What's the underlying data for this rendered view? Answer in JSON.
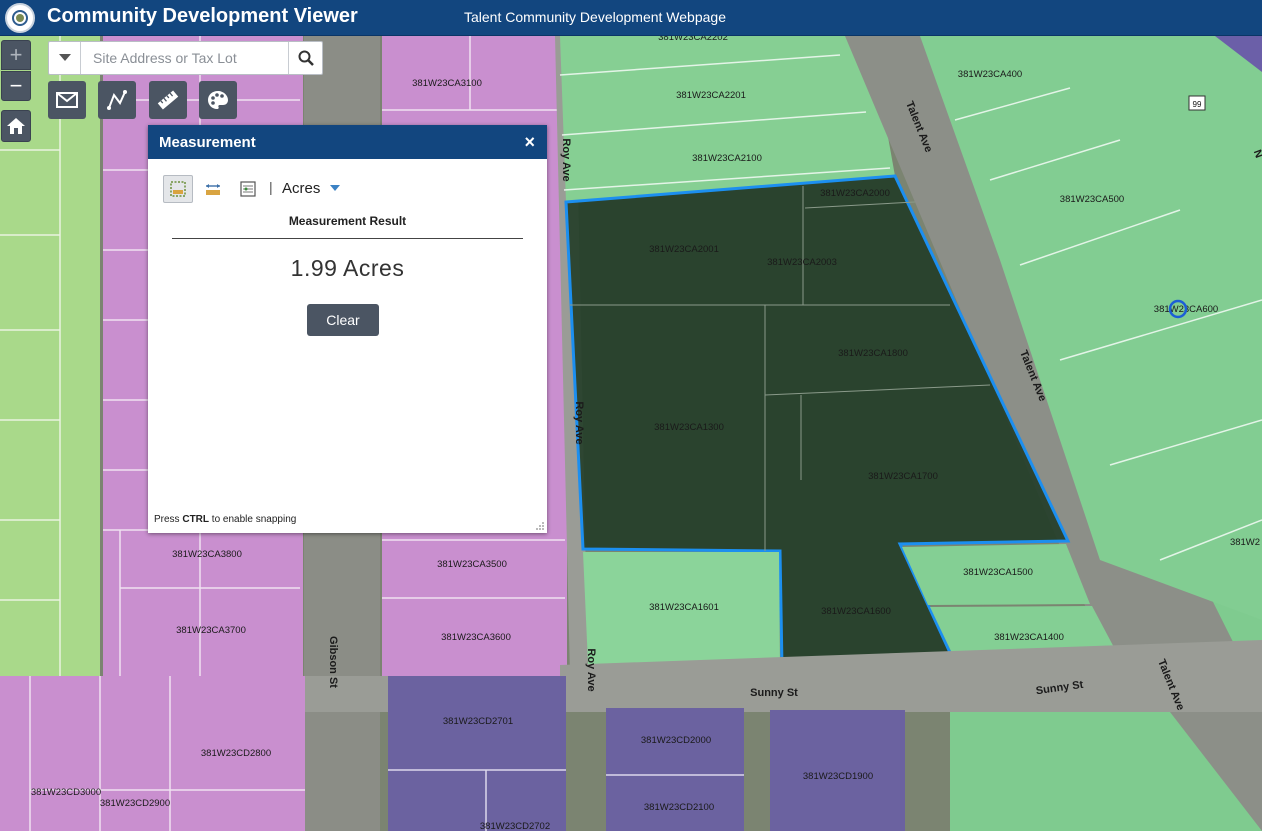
{
  "header": {
    "title": "Community Development Viewer",
    "subtitle": "Talent Community Development Webpage"
  },
  "search": {
    "placeholder": "Site Address or Tax Lot"
  },
  "toolbar": {
    "zoom_in": "+",
    "zoom_out": "−",
    "tools": [
      {
        "name": "email-tool",
        "icon": "envelope-icon"
      },
      {
        "name": "draw-tool",
        "icon": "draw-icon"
      },
      {
        "name": "measure-tool",
        "icon": "ruler-icon"
      },
      {
        "name": "basemap-tool",
        "icon": "palette-icon"
      }
    ]
  },
  "measurement": {
    "title": "Measurement",
    "close": "×",
    "unit_separator": "|",
    "unit": "Acres",
    "result_label": "Measurement Result",
    "result_value": "1.99 Acres",
    "clear_label": "Clear",
    "snap_prefix": "Press",
    "snap_key": "CTRL",
    "snap_suffix": "to enable snapping"
  },
  "map": {
    "colors": {
      "residential": "#d9a0dc",
      "commercial": "#8fd6a0",
      "lowdensity": "#b7e69a",
      "multifamily": "#6d64a6",
      "selection_fill": "#1f3a24",
      "selection_stroke": "#1c8ff0"
    },
    "parcel_labels": [
      "381W23CA2202",
      "381W23CA3100",
      "381W23CA2201",
      "381W23CA2100",
      "381W23CA400",
      "381W23CA2000",
      "381W23CA2001",
      "381W23CA2003",
      "381W23CA500",
      "381W23CA600",
      "381W23CA1800",
      "381W23CA1300",
      "381W23CA1700",
      "381W23CA1500",
      "381W23CA1601",
      "381W23CA1600",
      "381W23CA1400",
      "381W23CA3800",
      "381W23CA3500",
      "381W23CA3700",
      "381W23CA3600",
      "381W23CD2701",
      "381W23CD2800",
      "381W23CD2000",
      "381W23CD1900",
      "381W23CD2100",
      "381W23CD3000",
      "381W23CD2900",
      "381W23CD2702",
      "381W2"
    ],
    "street_labels": [
      "Roy Ave",
      "Roy Ave",
      "Roy Ave",
      "Talent Ave",
      "Talent Ave",
      "Talent Ave",
      "Gibson St",
      "Sunny St",
      "Sunny St",
      "N"
    ],
    "highway_shield": "99"
  }
}
